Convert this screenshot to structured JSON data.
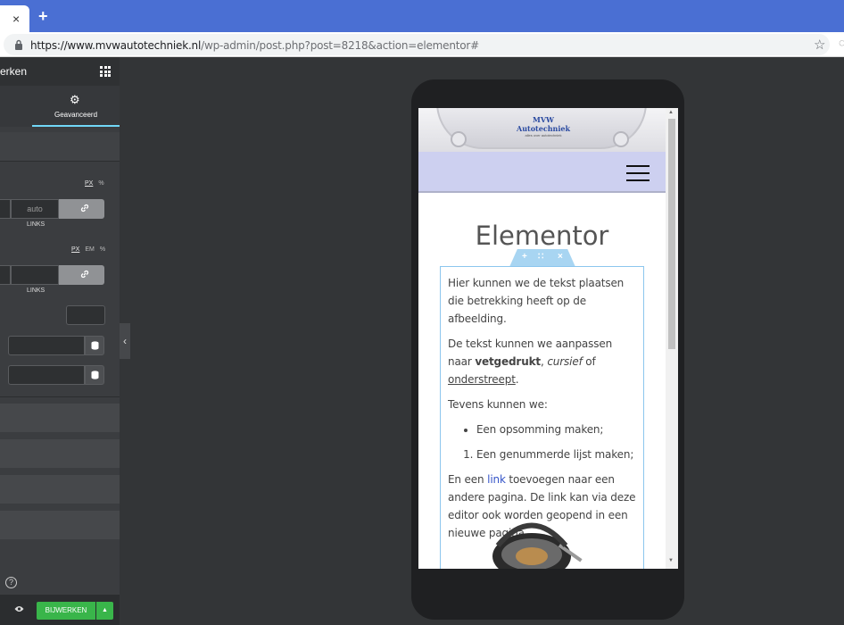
{
  "browser": {
    "tab_close": "×",
    "new_tab": "+",
    "url_host": "https://www.mvwautotechniek.nl",
    "url_path": "/wp-admin/post.php?post=8218&action=elementor#"
  },
  "panel": {
    "title": "erken",
    "active_tab": "Geavanceerd",
    "margin": {
      "units": [
        "PX",
        "%"
      ],
      "active_unit": "PX",
      "value_placeholder": "auto",
      "side_label": "LINKS"
    },
    "padding": {
      "units": [
        "PX",
        "EM",
        "%"
      ],
      "active_unit": "PX",
      "side_label": "LINKS"
    },
    "help": "?",
    "update_label": "BIJWERKEN",
    "update_arrow": "▲",
    "collapse": "‹"
  },
  "preview": {
    "logo_title": "MVW Autotechniek",
    "logo_sub": "alles over autotechniek",
    "heading": "Elementor",
    "edit_tab": {
      "add": "+",
      "move": "∷",
      "remove": "×"
    },
    "para1": "Hier kunnen we de tekst plaatsen die betrekking heeft op de afbeelding.",
    "para2_start": "De tekst kunnen we aanpassen naar ",
    "para2_bold": "vetgedrukt",
    "para2_sep": ", ",
    "para2_italic": "cursief",
    "para2_of": " of ",
    "para2_underline": "onderstreept",
    "para2_end": ".",
    "para3": "Tevens kunnen we:",
    "bullet_item": "Een opsomming maken;",
    "numbered_item": "Een genummerde lijst maken;",
    "para4_start": "En een ",
    "para4_link": "link",
    "para4_end": " toevoegen naar een andere pagina. De link kan via deze editor ook worden geopend in een nieuwe pagina.",
    "scroll_up": "▲",
    "scroll_down": "▼"
  },
  "colors": {
    "browser_accent": "#4a6fd3",
    "update_button": "#39b54a",
    "active_tab_underline": "#71d7f7",
    "navbar": "#cdd0f0"
  }
}
